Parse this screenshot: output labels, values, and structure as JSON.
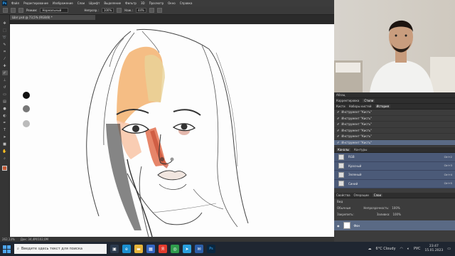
{
  "app": {
    "logo": "Ps"
  },
  "menu": [
    "Файл",
    "Редактирование",
    "Изображение",
    "Слои",
    "Шрифт",
    "Выделение",
    "Фильтр",
    "3D",
    "Просмотр",
    "Окно",
    "Справка"
  ],
  "options": {
    "mode_label": "Режим:",
    "mode_value": "Нормальный",
    "opacity_label": "Непрозр.:",
    "opacity_value": "100%",
    "flow_label": "Наж.:",
    "flow_value": "44%"
  },
  "document": {
    "tab_title": "Шаг.psd @ 73,5% (RGB/8) *"
  },
  "status": {
    "zoom": "262,13%",
    "doc_size": "Док: 34,4M/102,0M"
  },
  "panels": {
    "history_tabs": [
      "Абзац",
      "Корректировка",
      "Стили"
    ],
    "history_subtabs": [
      "Кисти",
      "Наборы кистей",
      "История"
    ],
    "history_items": [
      "Инструмент \"Кисть\"",
      "Инструмент \"Кисть\"",
      "Инструмент \"Кисть\"",
      "Инструмент \"Кисть\"",
      "Инструмент \"Кисть\"",
      "Инструмент \"Кисть\""
    ],
    "channels_tabs": [
      "Каналы",
      "Контуры"
    ],
    "channels": [
      {
        "name": "RGB",
        "key": "Ctrl+2"
      },
      {
        "name": "Красный",
        "key": "Ctrl+3"
      },
      {
        "name": "Зеленый",
        "key": "Ctrl+4"
      },
      {
        "name": "Синий",
        "key": "Ctrl+5"
      }
    ],
    "layers_tabs": [
      "Свойства",
      "Операции",
      "Слои"
    ],
    "layer_kind": "Вид",
    "layer_blend": "Обычные",
    "layer_opacity_label": "Непрозрачность:",
    "layer_opacity_value": "100%",
    "layer_lock_label": "Закрепить:",
    "layer_fill_label": "Заливка:",
    "layer_fill_value": "100%",
    "layer_name": "Фон"
  },
  "taskbar": {
    "search_placeholder": "Введите здесь текст для поиска",
    "weather": "6°C Cloudy",
    "lang": "РУС",
    "time": "23:47",
    "date": "15.01.2023"
  },
  "colors": {
    "accent": "#5a6a85",
    "fg_swatch": "#c45a35"
  }
}
